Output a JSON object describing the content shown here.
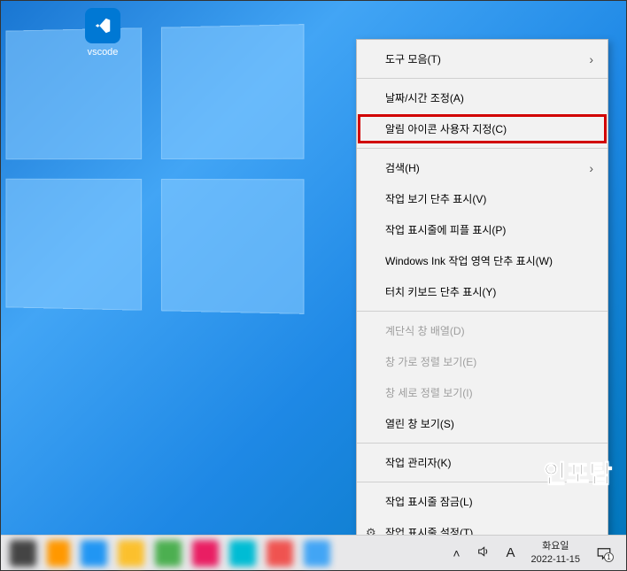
{
  "desktop": {
    "icons": [
      {
        "label": "vscode"
      }
    ]
  },
  "context_menu": {
    "items": [
      {
        "label": "도구 모음(T)",
        "has_submenu": true
      },
      {
        "separator": true
      },
      {
        "label": "날짜/시간 조정(A)"
      },
      {
        "label": "알림 아이콘 사용자 지정(C)",
        "highlighted": true
      },
      {
        "separator": true
      },
      {
        "label": "검색(H)",
        "has_submenu": true
      },
      {
        "label": "작업 보기 단추 표시(V)"
      },
      {
        "label": "작업 표시줄에 피플 표시(P)"
      },
      {
        "label": "Windows Ink 작업 영역 단추 표시(W)"
      },
      {
        "label": "터치 키보드 단추 표시(Y)"
      },
      {
        "separator": true
      },
      {
        "label": "계단식 창 배열(D)",
        "disabled": true
      },
      {
        "label": "창 가로 정렬 보기(E)",
        "disabled": true
      },
      {
        "label": "창 세로 정렬 보기(I)",
        "disabled": true
      },
      {
        "label": "열린 창 보기(S)"
      },
      {
        "separator": true
      },
      {
        "label": "작업 관리자(K)"
      },
      {
        "separator": true
      },
      {
        "label": "작업 표시줄 잠금(L)"
      },
      {
        "label": "작업 표시줄 설정(T)",
        "icon": "gear"
      }
    ]
  },
  "taskbar": {
    "ime_mode": "A",
    "clock_day": "화요일",
    "clock_date": "2022-11-15",
    "notification_count": "1"
  },
  "watermark": "인포탑"
}
